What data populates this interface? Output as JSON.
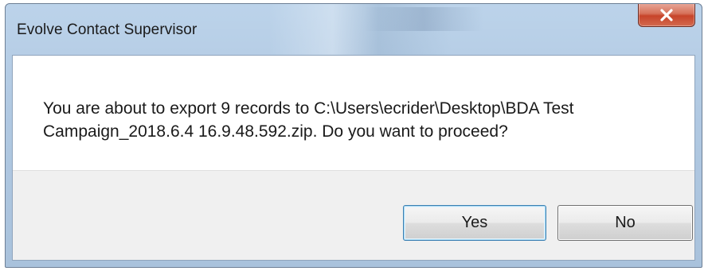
{
  "dialog": {
    "title": "Evolve Contact Supervisor",
    "message": "You are about to export 9 records to C:\\Users\\ecrider\\Desktop\\BDA Test Campaign_2018.6.4 16.9.48.592.zip. Do you want to proceed?",
    "buttons": {
      "yes_label": "Yes",
      "no_label": "No"
    },
    "close_icon": "close-x-icon",
    "colors": {
      "frame": "#b1c9e2",
      "close_button": "#c7442a",
      "button_bar": "#f0f0f0",
      "default_button_border": "#3c7fb1"
    }
  }
}
